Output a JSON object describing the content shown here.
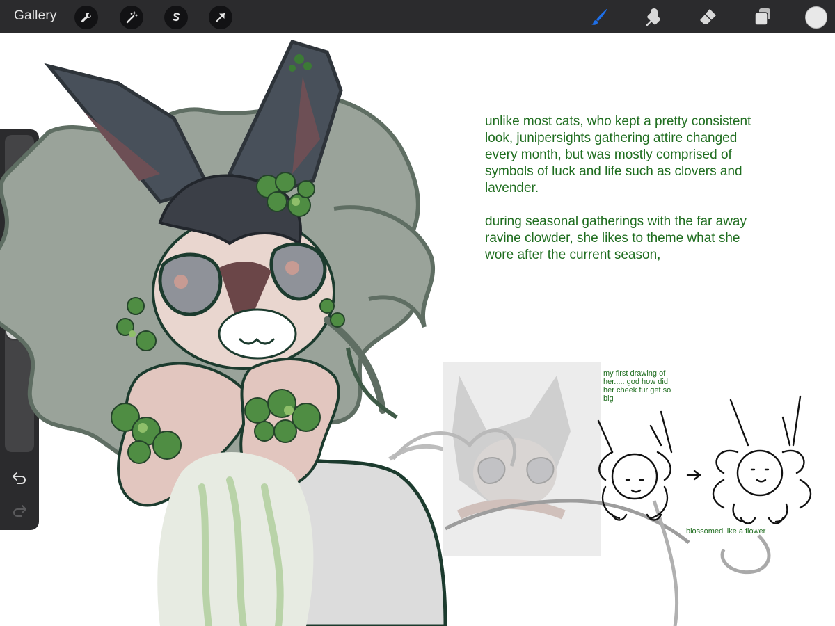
{
  "toolbar": {
    "gallery_label": "Gallery",
    "left_tools": [
      {
        "icon": "wrench-icon",
        "name": "actions"
      },
      {
        "icon": "magic-wand-icon",
        "name": "adjustments"
      },
      {
        "icon": "selection-s-icon",
        "name": "selection"
      },
      {
        "icon": "arrow-cursor-icon",
        "name": "transform"
      }
    ],
    "right_tools": [
      {
        "icon": "brush-icon",
        "name": "paint",
        "active": true
      },
      {
        "icon": "smudge-icon",
        "name": "smudge"
      },
      {
        "icon": "eraser-icon",
        "name": "erase"
      },
      {
        "icon": "layers-icon",
        "name": "layers"
      }
    ],
    "accent_color": "#1e6fe8",
    "current_color": "#e8e8e8"
  },
  "sidebar": {
    "brush_size_level": 0.35,
    "opacity_level": 0.95,
    "modify_icon": "square-icon",
    "undo_icon": "undo-arrow-icon",
    "redo_icon": "redo-arrow-icon"
  },
  "canvas": {
    "note_main": "unlike most cats, who kept a pretty consistent\nlook, junipersights gathering attire changed\nevery month, but was mostly comprised of\nsymbols of luck and life such as clovers and\nlavender.\n\nduring seasonal gatherings with the far away\nravine clowder, she likes to theme what she\nwore after the current season,",
    "note_small": "my first drawing of\nher..... god how did\nher cheek fur get so\nbig",
    "note_blossom": "blossomed like a flower",
    "text_color": "#1f6d1f"
  }
}
